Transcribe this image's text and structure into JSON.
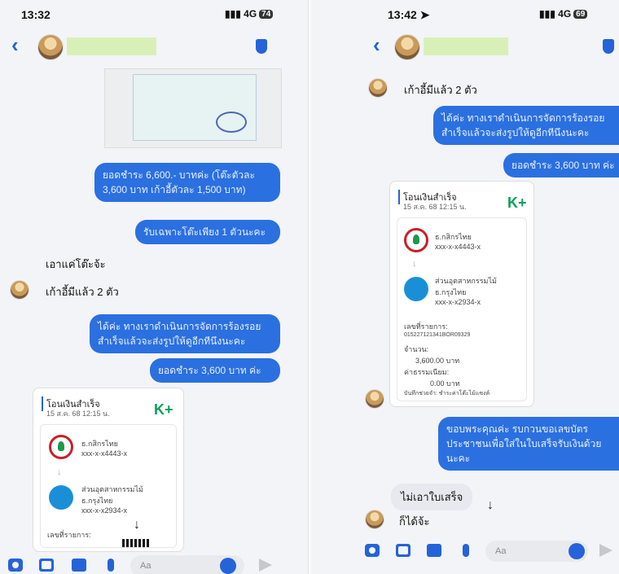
{
  "left": {
    "status": {
      "time": "13:32",
      "signal": "4G",
      "battery": "74"
    },
    "messages": {
      "out1": "ยอดชำระ 6,600.- บาทค่ะ (โต๊ะตัวละ 3,600 บาท เก้าอี้ตัวละ 1,500 บาท)",
      "out2": "รับเฉพาะโต๊ะเพียง 1 ตัวนะคะ",
      "in1": "เอาแค่โต๊ะจ้ะ",
      "in2": "เก้าอี้มีแล้ว 2 ตัว",
      "out3": "ได้ค่ะ ทางเราดำเนินการจัดการร้องรอย สำเร็จแล้วจะส่งรูปให้ดูอีกทีนึงนะคะ",
      "out4": "ยอดชำระ 3,600 บาท ค่ะ"
    },
    "receipt": {
      "title": "โอนเงินสำเร็จ",
      "date": "15 ส.ค. 68  12:15 น.",
      "logo": "K+",
      "from_bank": "ธ.กสิกรไทย",
      "from_acct": "xxx-x-x4443-x",
      "to_name": "ส่วนอุตสาหกรรมไม้",
      "to_bank": "ธ.กรุงไทย",
      "to_acct": "xxx-x-x2934-x",
      "ref_label": "เลขที่รายการ:"
    },
    "input_placeholder": "Aa"
  },
  "right": {
    "status": {
      "time": "13:42",
      "signal": "4G",
      "battery": "69"
    },
    "messages": {
      "in1": "เก้าอี้มีแล้ว 2 ตัว",
      "out1": "ได้ค่ะ ทางเราดำเนินการจัดการร้องรอย สำเร็จแล้วจะส่งรูปให้ดูอีกทีนึงนะคะ",
      "out2": "ยอดชำระ 3,600 บาท ค่ะ",
      "out3": "ขอบพระคุณค่ะ รบกวนขอเลขบัตรประชาชนเพื่อใส่ในใบเสร็จรับเงินด้วยนะคะ",
      "in2": "ไม่เอาใบเสร็จ",
      "in3": "ก็ได้จ้ะ"
    },
    "receipt": {
      "title": "โอนเงินสำเร็จ",
      "date": "15 ส.ค. 68  12:15 น.",
      "logo": "K+",
      "from_bank": "ธ.กสิกรไทย",
      "from_acct": "xxx-x-x4443-x",
      "to_name": "ส่วนอุตสาหกรรมไม้",
      "to_bank": "ธ.กรุงไทย",
      "to_acct": "xxx-x-x2934-x",
      "ref_label": "เลขที่รายการ:",
      "ref_value": "015227121341BOR09329",
      "amount_label": "จำนวน:",
      "amount": "3,600.00 บาท",
      "fee_label": "ค่าธรรมเนียม:",
      "fee": "0.00 บาท",
      "footer": "บันทึกช่วยจำ: ชำระค่าโต๊ะไม้แซงค์"
    },
    "input_placeholder": "Aa"
  },
  "icons": {
    "back": "chevron-left-icon",
    "shield": "shield-icon",
    "camera": "camera-icon",
    "image": "image-icon",
    "briefcase": "briefcase-icon",
    "mic": "mic-icon",
    "emoji": "emoji-icon",
    "send": "send-icon",
    "scroll": "arrow-down-icon"
  },
  "colors": {
    "accent": "#2b70e0",
    "kplus": "#0aa05a",
    "namebar": "#d8f0b8"
  }
}
